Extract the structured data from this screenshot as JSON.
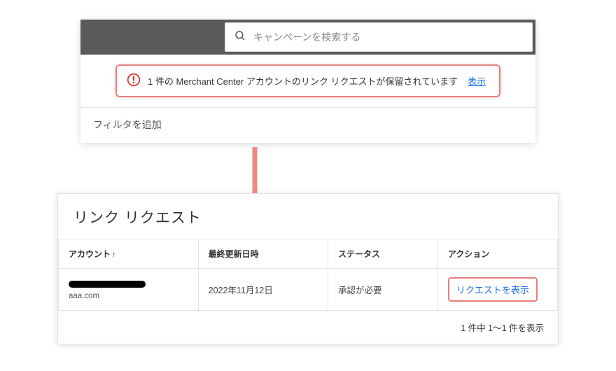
{
  "top": {
    "search_placeholder": "キャンペーンを検索する",
    "alert": {
      "text": "1 件の Merchant Center アカウントのリンク リクエストが保留されています",
      "show_label": "表示"
    },
    "filter_label": "フィルタを追加"
  },
  "bottom": {
    "title": "リンク リクエスト",
    "columns": {
      "account": "アカウント",
      "updated": "最終更新日時",
      "status": "ステータス",
      "action": "アクション"
    },
    "row": {
      "account_sub": "aaa.com",
      "updated": "2022年11月12日",
      "status": "承認が必要",
      "action": "リクエストを表示"
    },
    "pager": "1 件中 1～1 件を表示"
  }
}
